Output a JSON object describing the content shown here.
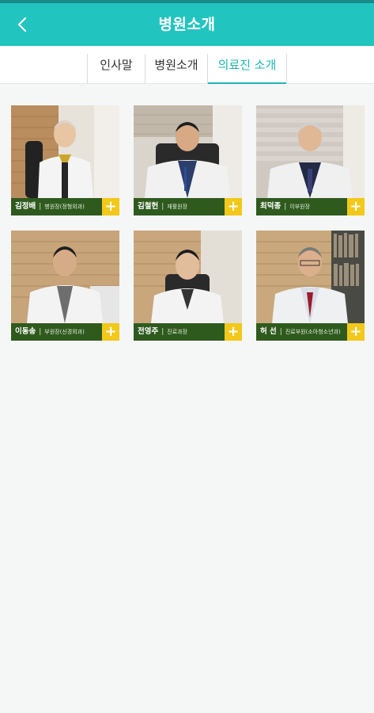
{
  "header": {
    "title": "병원소개",
    "back_icon": "chevron-left-icon"
  },
  "tabs": [
    {
      "label": "인사말",
      "active": false
    },
    {
      "label": "병원소개",
      "active": false
    },
    {
      "label": "의료진 소개",
      "active": true
    }
  ],
  "doctors": [
    {
      "name": "김정배",
      "role": "병원장(정형외과)"
    },
    {
      "name": "김철헌",
      "role": "재활원장"
    },
    {
      "name": "최덕종",
      "role": "이부원장"
    },
    {
      "name": "이동송",
      "role": "부원장(신경외과)"
    },
    {
      "name": "전영주",
      "role": "진료과장"
    },
    {
      "name": "허 선",
      "role": "진료부원(소아청소년과)"
    }
  ],
  "more_button_label": "+",
  "colors": {
    "accent": "#22c4c0",
    "tab_active": "#1fb7b3",
    "caption_bg": "#2f5a1e",
    "plus_bg": "#f2c81a"
  }
}
